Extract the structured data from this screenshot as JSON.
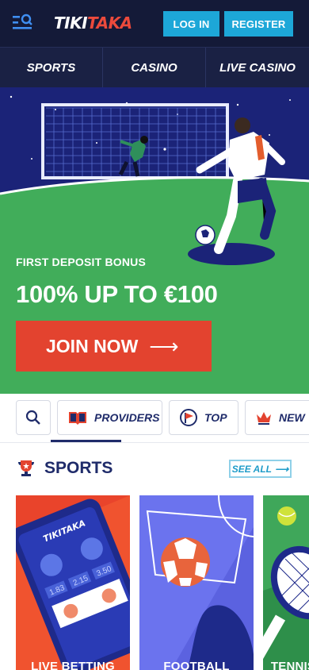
{
  "header": {
    "logo_part1": "TIKI",
    "logo_part2": "TAKA",
    "login_label": "LOG IN",
    "register_label": "REGISTER",
    "menu_icon": "menu-search-icon"
  },
  "nav": {
    "tabs": [
      {
        "label": "SPORTS"
      },
      {
        "label": "CASINO"
      },
      {
        "label": "LIVE CASINO"
      }
    ]
  },
  "hero": {
    "eyebrow": "FIRST DEPOSIT BONUS",
    "title": "100% UP TO €100",
    "cta_label": "JOIN NOW",
    "cta_icon": "arrow-right-icon"
  },
  "filters": {
    "search_icon": "search-icon",
    "items": [
      {
        "label": "PROVIDERS",
        "icon": "book-icon"
      },
      {
        "label": "TOP",
        "icon": "flag-icon"
      },
      {
        "label": "NEW",
        "icon": "crown-icon"
      }
    ]
  },
  "sports": {
    "title": "SPORTS",
    "see_all": "SEE ALL",
    "cards": [
      {
        "label": "LIVE BETTING",
        "logo_text": "TIKITAKA",
        "odds": [
          "1.83",
          "2.15",
          "3.50"
        ]
      },
      {
        "label": "FOOTBALL"
      },
      {
        "label": "TENNIS"
      }
    ]
  },
  "colors": {
    "header_bg": "#141a38",
    "nav_bg": "#1a2144",
    "brand_blue": "#1da7d8",
    "brand_red": "#e3432f",
    "navy_text": "#1f2b6a"
  }
}
